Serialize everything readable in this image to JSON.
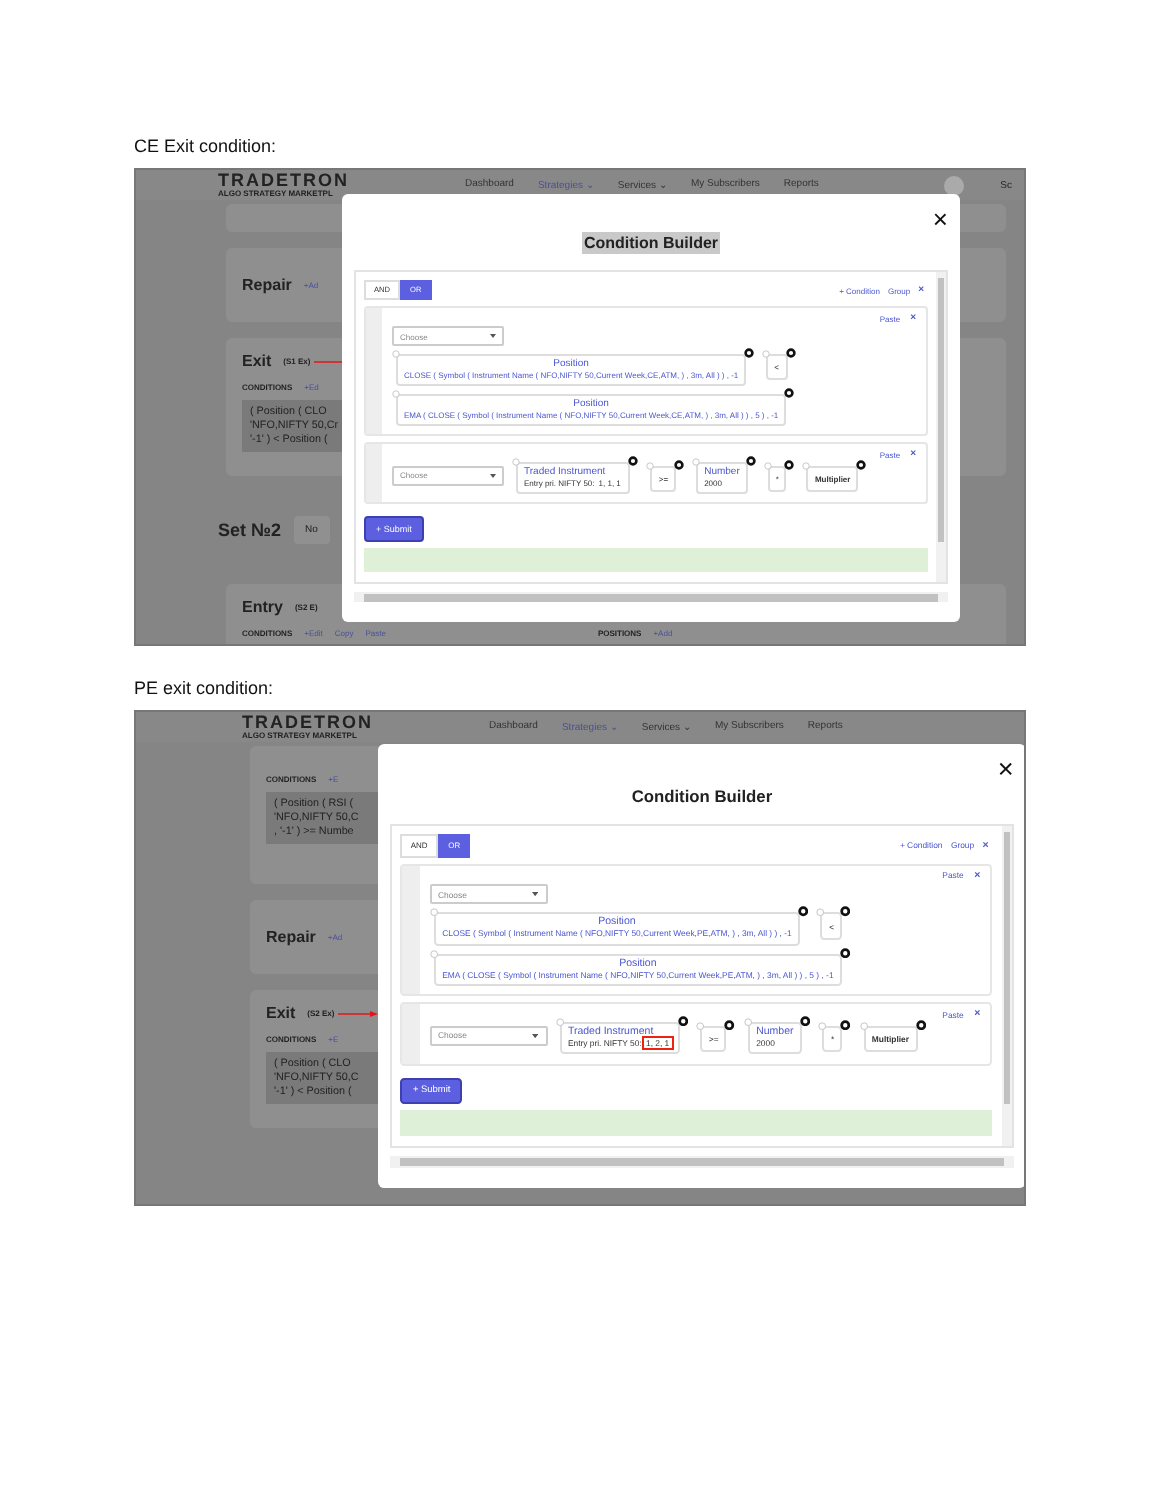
{
  "shots": [
    {
      "caption": "CE Exit condition:",
      "app": {
        "logo": "TRADETRON",
        "tagline": "ALGO STRATEGY MARKETPL",
        "user": "Sc",
        "nav": [
          {
            "label": "Dashboard",
            "selected": false
          },
          {
            "label": "Strategies ⌄",
            "selected": true
          },
          {
            "label": "Services ⌄",
            "selected": false
          },
          {
            "label": "My Subscribers",
            "selected": false
          },
          {
            "label": "Reports",
            "selected": false
          }
        ]
      },
      "cards": [
        {
          "kind": "card"
        },
        {
          "kind": "card",
          "title": "Repair",
          "action": "+Ad"
        },
        {
          "kind": "card",
          "title": "Exit",
          "tag": "(S1 Ex)",
          "arrow": true,
          "conditions": {
            "label": "CONDITIONS",
            "actions": [
              "+Ed"
            ],
            "lines": [
              "( Position ( CLO",
              "'NFO,NIFTY 50,Cr",
              "'-1' ) < Position ("
            ]
          }
        },
        {
          "kind": "set",
          "title": "Set №2",
          "button": "No"
        },
        {
          "kind": "card",
          "title": "Entry",
          "tag": "(S2 E)",
          "conditions": {
            "label": "CONDITIONS",
            "actions": [
              "+Edit",
              "Copy",
              "Paste"
            ]
          },
          "positions": {
            "label": "POSITIONS",
            "action": "+Add"
          }
        }
      ],
      "modal": {
        "close": "×",
        "title": "Condition Builder",
        "title_highlighted": true,
        "logic": [
          {
            "label": "AND",
            "selected": false
          },
          {
            "label": "OR",
            "selected": true
          }
        ],
        "add_condition": "+ Condition",
        "add_group": "Group",
        "remove": "×",
        "group": {
          "paste": "Paste",
          "remove": "×",
          "choose": "Choose",
          "left": {
            "title": "Position",
            "expr": "CLOSE ( Symbol ( Instrument Name ( NFO,NIFTY 50,Current Week,CE,ATM, ) , 3m, All ) ) , -1"
          },
          "operator": "<",
          "right": {
            "title": "Position",
            "expr": "EMA ( CLOSE ( Symbol ( Instrument Name ( NFO,NIFTY 50,Current Week,CE,ATM, ) , 3m, All ) ) , 5 ) , -1"
          }
        },
        "rule": {
          "paste": "Paste",
          "remove": "×",
          "choose": "Choose",
          "instrument": {
            "title": "Traded Instrument",
            "detail": "Entry pri. NIFTY 50:",
            "params": "1, 1, 1",
            "params_highlighted": false
          },
          "operator": ">=",
          "number": {
            "title": "Number",
            "value": "2000"
          },
          "multiply": "*",
          "multiplier": "Multiplier"
        },
        "submit": "+ Submit"
      }
    },
    {
      "caption": "PE exit condition:",
      "app": {
        "logo": "TRADETRON",
        "tagline": "ALGO STRATEGY MARKETPL",
        "nav": [
          {
            "label": "Dashboard",
            "selected": false
          },
          {
            "label": "Strategies ⌄",
            "selected": true
          },
          {
            "label": "Services ⌄",
            "selected": false
          },
          {
            "label": "My Subscribers",
            "selected": false
          },
          {
            "label": "Reports",
            "selected": false
          }
        ]
      },
      "cards": [
        {
          "kind": "card",
          "conditions": {
            "label": "CONDITIONS",
            "actions": [
              "+E"
            ],
            "lines": [
              "( Position ( RSI (",
              "'NFO,NIFTY 50,C",
              ", '-1' ) >= Numbe"
            ]
          }
        },
        {
          "kind": "card",
          "title": "Repair",
          "action": "+Ad"
        },
        {
          "kind": "card",
          "title": "Exit",
          "tag": "(S2 Ex)",
          "arrow": true,
          "conditions": {
            "label": "CONDITIONS",
            "actions": [
              "+E"
            ],
            "lines": [
              "( Position ( CLO",
              "'NFO,NIFTY 50,C",
              "'-1' ) < Position ("
            ]
          }
        }
      ],
      "modal": {
        "close": "×",
        "title": "Condition Builder",
        "title_highlighted": false,
        "logic": [
          {
            "label": "AND",
            "selected": false
          },
          {
            "label": "OR",
            "selected": true
          }
        ],
        "add_condition": "+ Condition",
        "add_group": "Group",
        "remove": "×",
        "group": {
          "paste": "Paste",
          "remove": "×",
          "choose": "Choose",
          "left": {
            "title": "Position",
            "expr": "CLOSE ( Symbol ( Instrument Name ( NFO,NIFTY 50,Current Week,PE,ATM, ) , 3m, All ) ) , -1"
          },
          "operator": "<",
          "right": {
            "title": "Position",
            "expr": "EMA ( CLOSE ( Symbol ( Instrument Name ( NFO,NIFTY 50,Current Week,PE,ATM, ) , 3m, All ) ) , 5 ) , -1"
          }
        },
        "rule": {
          "paste": "Paste",
          "remove": "×",
          "choose": "Choose",
          "instrument": {
            "title": "Traded Instrument",
            "detail": "Entry pri. NIFTY 50:",
            "params": "1, 2, 1",
            "params_highlighted": true
          },
          "operator": ">=",
          "number": {
            "title": "Number",
            "value": "2000"
          },
          "multiply": "*",
          "multiplier": "Multiplier"
        },
        "submit": "+ Submit"
      }
    }
  ]
}
